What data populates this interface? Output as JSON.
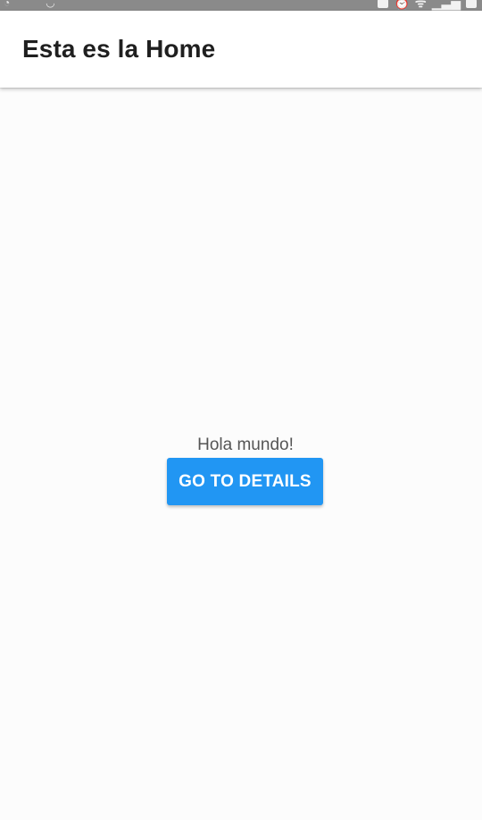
{
  "app_bar": {
    "title": "Esta es la Home"
  },
  "main": {
    "greeting": "Hola mundo!",
    "details_button_label": "GO TO DETAILS"
  },
  "colors": {
    "accent": "#2196f3",
    "app_bar_background": "#ffffff",
    "page_background": "#fcfcfc",
    "status_bar_background": "#8a8a8a"
  },
  "icons": {
    "status_left": [
      "whatsapp-icon",
      "phone-icon"
    ],
    "status_right": [
      "sd-card-icon",
      "alarm-icon",
      "wifi-icon",
      "signal-icon",
      "battery-icon"
    ]
  }
}
